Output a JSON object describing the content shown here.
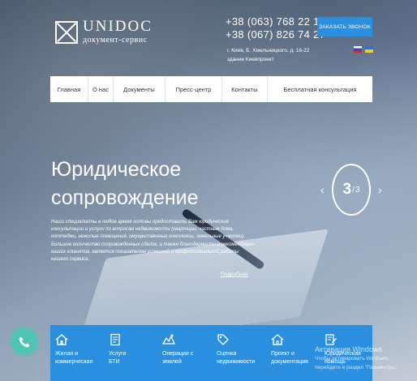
{
  "logo": {
    "title": "UNIDOC",
    "subtitle": "документ-сервис"
  },
  "contacts": {
    "phones": [
      "+38 (063) 768 22 10",
      "+38 (067) 826 74 27"
    ],
    "address": "г. Киев, Б. Хмельницкого, д. 16-22 здание Киевпроект"
  },
  "callback_label": "Заказать звонок",
  "languages": [
    "ru-flag",
    "ua-flag"
  ],
  "nav": {
    "items": [
      {
        "label": "Главная"
      },
      {
        "label": "О нас"
      },
      {
        "label": "Документы"
      },
      {
        "label": "Пресс-центр"
      },
      {
        "label": "Контакты"
      },
      {
        "label": "Бесплатная консультация"
      }
    ]
  },
  "hero": {
    "title_line1": "Юридическое",
    "title_line2": "сопровождение",
    "text": "Наши специалисты в любое время готовы предоставить Вам юридические консультации и услуги по вопросам недвижимости (квартиры, частные дома, коттеджи, нежилые помещения, имущественные комплексы, земельные участки). Большое количество сопровожденных сделок, а также благодарности и рекомендации наших клиентов, является показателем успешной и профессиональной работы нашего сервиса.",
    "more_link": "Подробнее"
  },
  "slider": {
    "current": "3",
    "separator": "/",
    "total": "3",
    "prev": "‹",
    "next": "›"
  },
  "services": [
    {
      "line1": "Жилая и",
      "line2": "коммерческая",
      "icon": "house-icon"
    },
    {
      "line1": "Услуги",
      "line2": "БТИ",
      "icon": "document-icon"
    },
    {
      "line1": "Операции с",
      "line2": "землей",
      "icon": "land-icon"
    },
    {
      "line1": "Оценка",
      "line2": "недвижимости",
      "icon": "price-tag-icon"
    },
    {
      "line1": "Проект и",
      "line2": "документация",
      "icon": "house-plan-icon"
    },
    {
      "line1": "Юридическая",
      "line2": "помощь",
      "icon": "legal-icon"
    }
  ],
  "windows_activation": {
    "title": "Активация Windows",
    "line1": "Чтобы активировать Windows,",
    "line2": "перейдите в раздел \"Параметры\"."
  },
  "colors": {
    "accent": "#2b8fe0",
    "phone_fab": "#4fc4b4",
    "text": "#333333"
  }
}
